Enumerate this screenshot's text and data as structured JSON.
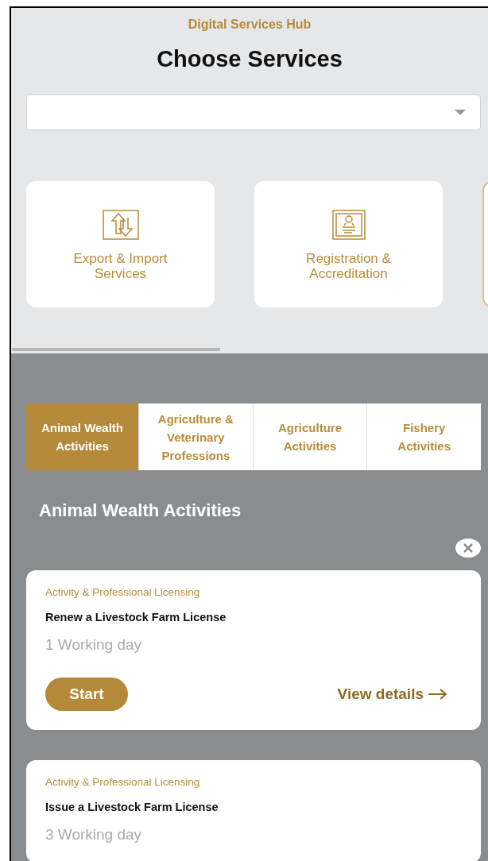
{
  "header": {
    "subtitle": "Digital Services Hub",
    "title": "Choose Services"
  },
  "categories": [
    {
      "label": "Export & Import Services",
      "kind": "transfer",
      "selected": false
    },
    {
      "label": "Registration & Accreditation",
      "kind": "certificate",
      "selected": false
    },
    {
      "kind": "blank",
      "selected": true
    }
  ],
  "tabs": [
    {
      "label": "Animal Wealth Activities",
      "selected": true
    },
    {
      "label": "Agriculture & Veterinary Professions",
      "selected": false
    },
    {
      "label": "Agriculture Activities",
      "selected": false
    },
    {
      "label": "Fishery Activities",
      "selected": false
    }
  ],
  "section_title": "Animal Wealth Activities",
  "services": [
    {
      "category": "Activity & Professional Licensing",
      "name": "Renew a Livestock Farm License",
      "duration": "1 Working day",
      "start": "Start",
      "details": "View details"
    },
    {
      "category": "Activity & Professional Licensing",
      "name": "Issue a Livestock Farm License",
      "duration": "3 Working day"
    }
  ]
}
